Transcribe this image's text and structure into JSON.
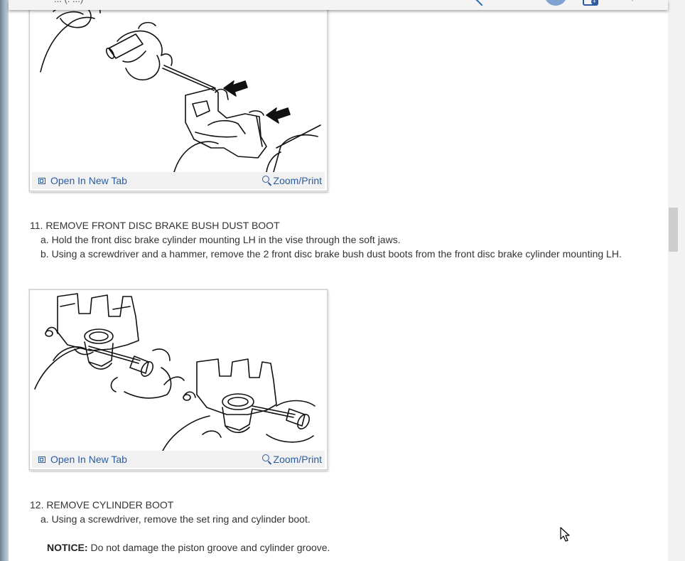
{
  "header": {
    "title_fragment": "... (. ...)",
    "trailing_mark": ","
  },
  "figures": [
    {
      "image_icon": "brake-caliper-slide-pin-illustration",
      "open_tab_label": "Open In New Tab",
      "zoom_label": "Zoom/Print",
      "open_tab_icon": "open-new-tab-icon",
      "zoom_icon": "magnifier-icon"
    },
    {
      "image_icon": "brake-bush-dust-boot-illustration",
      "open_tab_label": "Open In New Tab",
      "zoom_label": "Zoom/Print",
      "open_tab_icon": "open-new-tab-icon",
      "zoom_icon": "magnifier-icon"
    }
  ],
  "steps": [
    {
      "heading": "11. REMOVE FRONT DISC BRAKE BUSH DUST BOOT",
      "items": [
        "a. Hold the front disc brake cylinder mounting LH in the vise through the soft jaws.",
        "b. Using a screwdriver and a hammer, remove the 2 front disc brake bush dust boots from the front disc brake cylinder mounting LH."
      ]
    },
    {
      "heading": "12. REMOVE CYLINDER BOOT",
      "items": [
        "a. Using a screwdriver, remove the set ring and cylinder boot."
      ],
      "notice_label": "NOTICE:",
      "notice_text": " Do not damage the piston groove and cylinder groove."
    }
  ],
  "colors": {
    "link": "#2c5c9c",
    "text": "#333333",
    "image_bar": "#f1f1f1"
  }
}
